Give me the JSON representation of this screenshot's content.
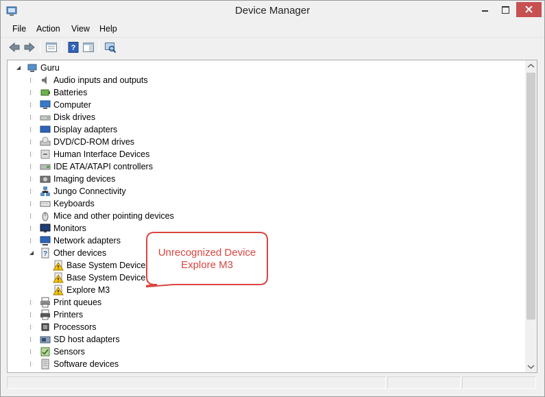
{
  "window": {
    "title": "Device Manager"
  },
  "menu": [
    "File",
    "Action",
    "View",
    "Help"
  ],
  "tree": {
    "root": "Guru",
    "categories": [
      {
        "label": "Audio inputs and outputs",
        "icon": "speaker-icon"
      },
      {
        "label": "Batteries",
        "icon": "battery-icon"
      },
      {
        "label": "Computer",
        "icon": "computer-icon"
      },
      {
        "label": "Disk drives",
        "icon": "disk-drive-icon"
      },
      {
        "label": "Display adapters",
        "icon": "display-adapter-icon"
      },
      {
        "label": "DVD/CD-ROM drives",
        "icon": "dvd-drive-icon"
      },
      {
        "label": "Human Interface Devices",
        "icon": "hid-icon"
      },
      {
        "label": "IDE ATA/ATAPI controllers",
        "icon": "ide-controller-icon"
      },
      {
        "label": "Imaging devices",
        "icon": "camera-icon"
      },
      {
        "label": "Jungo Connectivity",
        "icon": "network-icon"
      },
      {
        "label": "Keyboards",
        "icon": "keyboard-icon"
      },
      {
        "label": "Mice and other pointing devices",
        "icon": "mouse-icon"
      },
      {
        "label": "Monitors",
        "icon": "monitor-icon"
      },
      {
        "label": "Network adapters",
        "icon": "network-adapter-icon"
      },
      {
        "label": "Other devices",
        "icon": "unknown-device-icon",
        "expanded": true,
        "children": [
          "Base System Device",
          "Base System Device",
          "Explore M3"
        ]
      },
      {
        "label": "Print queues",
        "icon": "print-queue-icon"
      },
      {
        "label": "Printers",
        "icon": "printer-icon"
      },
      {
        "label": "Processors",
        "icon": "processor-icon"
      },
      {
        "label": "SD host adapters",
        "icon": "sd-card-icon"
      },
      {
        "label": "Sensors",
        "icon": "sensor-icon"
      },
      {
        "label": "Software devices",
        "icon": "software-device-icon"
      }
    ]
  },
  "callout": {
    "line1": "Unrecognized Device",
    "line2": "Explore M3"
  },
  "colors": {
    "callout": "#d9443f",
    "warning": "#f5c400",
    "close": "#c75050"
  }
}
